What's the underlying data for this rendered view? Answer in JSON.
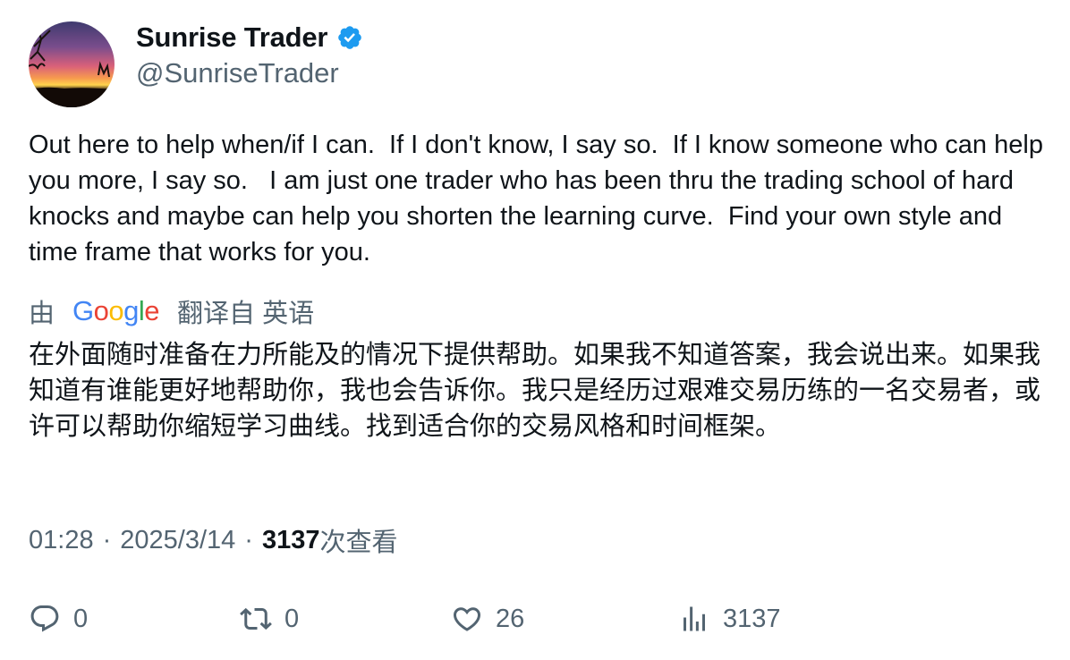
{
  "author": {
    "display_name": "Sunrise Trader",
    "handle": "@SunriseTrader",
    "verified": true,
    "verified_color": "#1d9bf0"
  },
  "tweet": {
    "text": "Out here to help when/if I can.  If I don't know, I say so.  If I know someone who can help you more, I say so.   I am just one trader who has been thru the trading school of hard knocks and maybe can help you shorten the learning curve.  Find your own style and time frame that works for you."
  },
  "translation": {
    "prefix": "由",
    "provider": "Google",
    "suffix": "翻译自 英语",
    "text": "在外面随时准备在力所能及的情况下提供帮助。如果我不知道答案，我会说出来。如果我知道有谁能更好地帮助你，我也会告诉你。我只是经历过艰难交易历练的一名交易者，或许可以帮助你缩短学习曲线。找到适合你的交易风格和时间框架。"
  },
  "meta": {
    "time": "01:28",
    "separator": "·",
    "date": "2025/3/14",
    "views_count": "3137",
    "views_label": "次查看"
  },
  "actions": {
    "reply_count": "0",
    "repost_count": "0",
    "like_count": "26",
    "views_count": "3137"
  },
  "colors": {
    "text_primary": "#0f1419",
    "text_secondary": "#536471",
    "google_blue": "#4285f4",
    "google_red": "#ea4335",
    "google_yellow": "#fbbc05",
    "google_green": "#34a853"
  },
  "icons": [
    "verified-badge-icon",
    "reply-icon",
    "repost-icon",
    "like-icon",
    "views-icon"
  ]
}
